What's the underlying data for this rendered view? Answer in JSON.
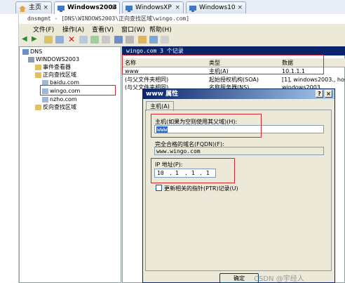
{
  "tabs": [
    {
      "label": "主页"
    },
    {
      "label": "Windows2003"
    },
    {
      "label": "WindowsXP"
    },
    {
      "label": "Windows10"
    }
  ],
  "window_title": "dnsmgmt - [DNS\\WINDOWS2003\\正向查找区域\\wingo.com]",
  "menu": [
    "文件(F)",
    "操作(A)",
    "查看(V)",
    "窗口(W)",
    "帮助(H)"
  ],
  "tree": {
    "dns": "DNS",
    "server": "WINDOWS2003",
    "event_viewer": "事件查看器",
    "forward_zones": "正向查找区域",
    "zone1": "baidu.com",
    "zone2": "wingo.com",
    "zone3": "nzho.com",
    "reverse_zones": "反向查找区域"
  },
  "list": {
    "header": "wingo.com   3 个记录",
    "columns": [
      "名称",
      "类型",
      "数据"
    ],
    "rows": [
      {
        "name": "www",
        "type": "主机(A)",
        "data": "10.1.1.1"
      },
      {
        "name": "(与父文件夹相同)",
        "type": "起始授权机构(SOA)",
        "data": "[1], windows2003., hos"
      },
      {
        "name": "(与父文件夹相同)",
        "type": "名称服务器(NS)",
        "data": "windows2003."
      }
    ]
  },
  "dialog": {
    "title": "www 属性",
    "help_btn": "?",
    "close_btn": "×",
    "tab": "主机(A)",
    "host_label": "主机(如果为空则使用其父域)(H):",
    "host_value": "www",
    "fqdn_label": "完全合格的域名(FQDN)(F):",
    "fqdn_value": "www.wingo.com",
    "ip_label": "IP 地址(P):",
    "ip": [
      "10",
      "1",
      "1",
      "1"
    ],
    "ptr_label": "更新相关的指针(PTR)记录(U)",
    "ok_button": "确定"
  },
  "watermark": "CSDN @宇经人",
  "colors": {
    "highlight": "#d6242a",
    "title_blue": "#0a246a",
    "face": "#ece9d8"
  }
}
